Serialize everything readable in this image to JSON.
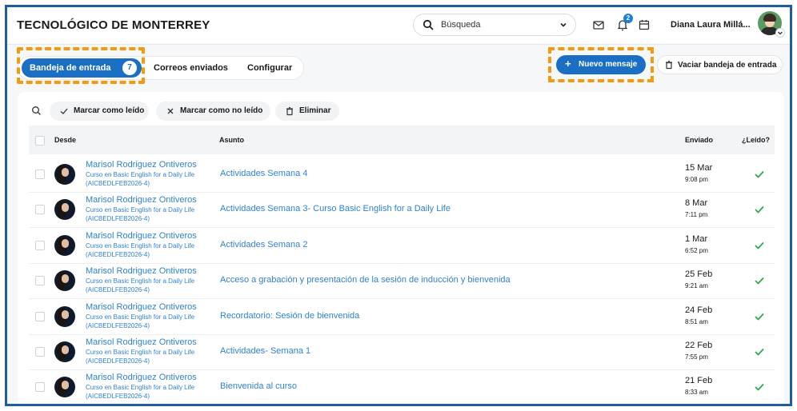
{
  "header": {
    "brand": "TECNOLÓGICO DE MONTERREY",
    "search_placeholder": "Búsqueda",
    "notification_count": "2",
    "user_name": "Diana Laura Millá..."
  },
  "tabs": {
    "inbox_label": "Bandeja de entrada",
    "inbox_count": "7",
    "sent_label": "Correos enviados",
    "config_label": "Configurar"
  },
  "actions": {
    "new_message": "Nuevo mensaje",
    "empty_inbox": "Vaciar bandeja de entrada",
    "mark_read": "Marcar como leído",
    "mark_unread": "Marcar como no leído",
    "delete": "Eliminar"
  },
  "table": {
    "col_from": "Desde",
    "col_subject": "Asunto",
    "col_sent": "Enviado",
    "col_read": "¿Leído?",
    "rows": [
      {
        "sender": "Marisol Rodriguez Ontiveros",
        "course": "Curso en Basic English for a Daily Life",
        "code": "(AICBEDLFEB2026-4)",
        "subject": "Actividades Semana 4",
        "date": "15 Mar",
        "time": "9:08 pm"
      },
      {
        "sender": "Marisol Rodriguez Ontiveros",
        "course": "Curso en Basic English for a Daily Life",
        "code": "(AICBEDLFEB2026-4)",
        "subject": "Actividades Semana 3- Curso Basic English for a Daily Life",
        "date": "8 Mar",
        "time": "7:11 pm"
      },
      {
        "sender": "Marisol Rodriguez Ontiveros",
        "course": "Curso en Basic English for a Daily Life",
        "code": "(AICBEDLFEB2026-4)",
        "subject": "Actividades Semana 2",
        "date": "1 Mar",
        "time": "6:52 pm"
      },
      {
        "sender": "Marisol Rodriguez Ontiveros",
        "course": "Curso en Basic English for a Daily Life",
        "code": "(AICBEDLFEB2026-4)",
        "subject": "Acceso a grabación y presentación de la sesión de inducción y bienvenida",
        "date": "25 Feb",
        "time": "9:21 am"
      },
      {
        "sender": "Marisol Rodriguez Ontiveros",
        "course": "Curso en Basic English for a Daily Life",
        "code": "(AICBEDLFEB2026-4)",
        "subject": "Recordatorio: Sesión de bienvenida",
        "date": "24 Feb",
        "time": "8:51 am"
      },
      {
        "sender": "Marisol Rodriguez Ontiveros",
        "course": "Curso en Basic English for a Daily Life",
        "code": "(AICBEDLFEB2026-4)",
        "subject": "Actividades- Semana 1",
        "date": "22 Feb",
        "time": "7:55 pm"
      },
      {
        "sender": "Marisol Rodriguez Ontiveros",
        "course": "Curso en Basic English for a Daily Life",
        "code": "(AICBEDLFEB2026-4)",
        "subject": "Bienvenida al curso",
        "date": "21 Feb",
        "time": "8:33 am"
      }
    ]
  },
  "colors": {
    "accent": "#1a6fc4",
    "link": "#2f82d0",
    "highlight": "#f59a0c",
    "read_check": "#2fa84f"
  }
}
